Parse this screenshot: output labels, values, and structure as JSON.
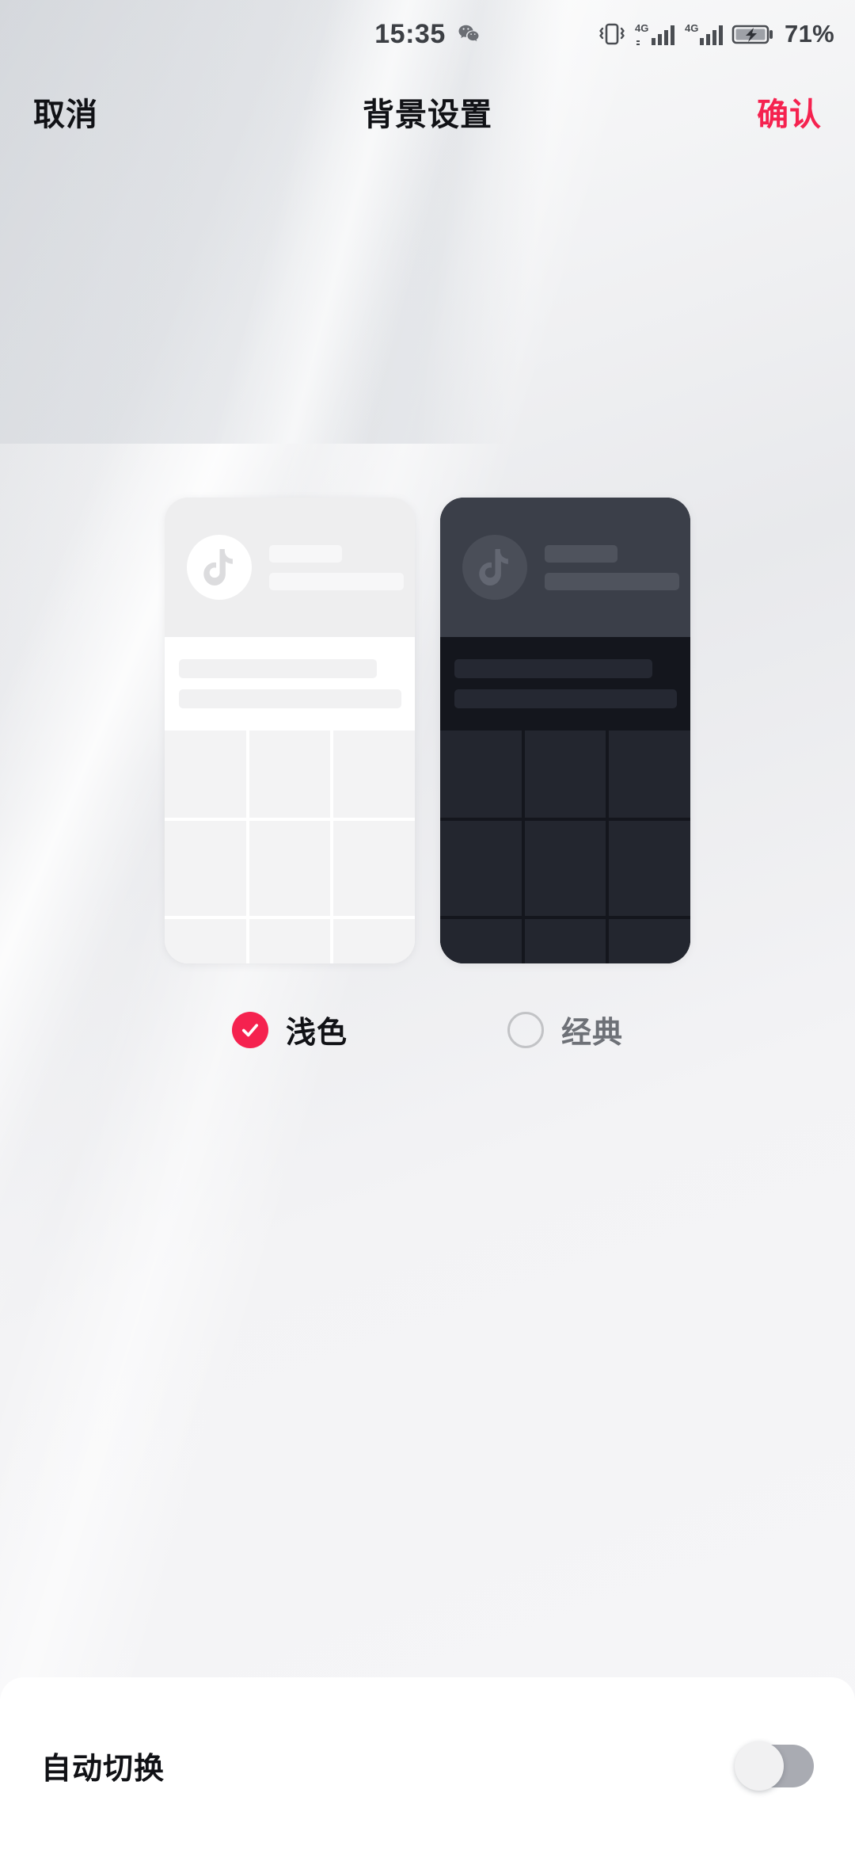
{
  "status_bar": {
    "time": "15:35",
    "notification_icon": "wechat-icon",
    "icons": [
      "vibrate-icon",
      "signal-4g-icon",
      "signal-4g-icon",
      "battery-charging-icon"
    ],
    "battery_percent": "71%"
  },
  "nav": {
    "cancel_label": "取消",
    "title": "背景设置",
    "confirm_label": "确认",
    "confirm_color": "#f5224f"
  },
  "themes": {
    "options": [
      {
        "id": "light",
        "label": "浅色",
        "selected": true
      },
      {
        "id": "classic",
        "label": "经典",
        "selected": false
      }
    ],
    "selected_color": "#f5224f",
    "unselected_color": "#c2c3c6"
  },
  "bottom": {
    "auto_switch_label": "自动切换",
    "auto_switch_on": false
  }
}
